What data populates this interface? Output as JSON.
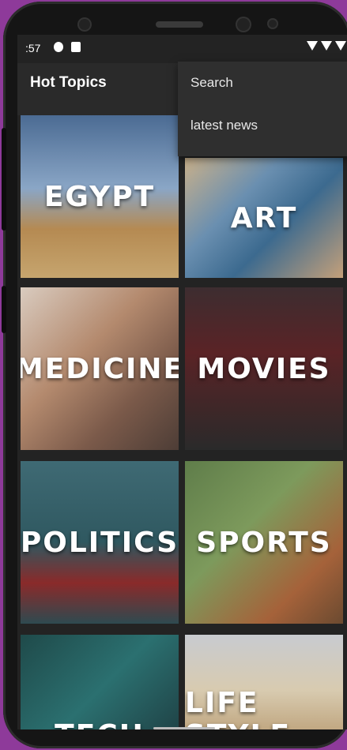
{
  "status": {
    "time": ":57"
  },
  "appbar": {
    "title": "Hot Topics"
  },
  "menu": {
    "items": [
      "Search",
      "latest news"
    ]
  },
  "tiles": [
    {
      "label": "EGYPT"
    },
    {
      "label": "ART"
    },
    {
      "label": "MEDICINE"
    },
    {
      "label": "MOVIES"
    },
    {
      "label": "POLITICS"
    },
    {
      "label": "SPORTS"
    },
    {
      "label": "TECH"
    },
    {
      "label": "LIFE STYLE"
    }
  ],
  "colors": {
    "background": "#8e3a9a",
    "appbar": "#2a2a2a",
    "menu": "#2f2f2f"
  }
}
